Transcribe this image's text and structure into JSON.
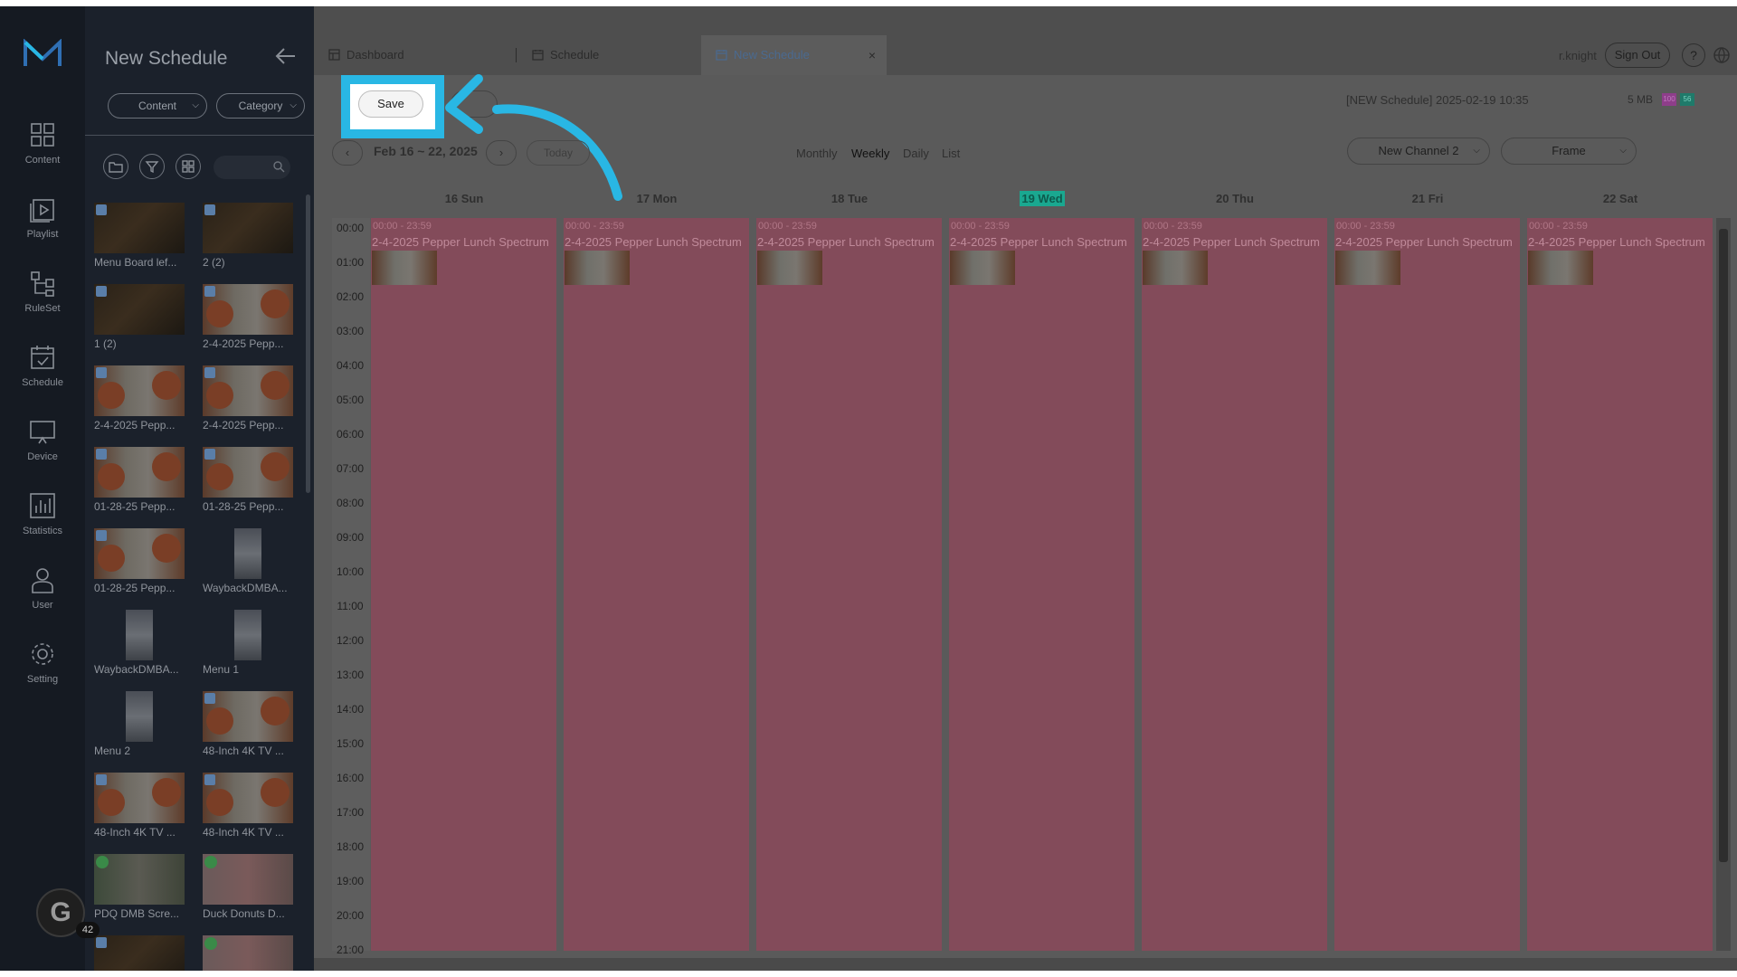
{
  "nav": {
    "items": [
      {
        "label": "Content",
        "icon": "grid-icon"
      },
      {
        "label": "Playlist",
        "icon": "playlist-icon"
      },
      {
        "label": "RuleSet",
        "icon": "ruleset-icon"
      },
      {
        "label": "Schedule",
        "icon": "calendar-icon"
      },
      {
        "label": "Device",
        "icon": "monitor-icon"
      },
      {
        "label": "Statistics",
        "icon": "chart-icon"
      },
      {
        "label": "User",
        "icon": "user-icon"
      },
      {
        "label": "Setting",
        "icon": "gear-icon"
      }
    ]
  },
  "panel": {
    "title": "New Schedule",
    "content_filter": "Content",
    "category_filter": "Category",
    "search_placeholder": "",
    "items": [
      {
        "caption": "Menu Board lef...",
        "kind": "dark"
      },
      {
        "caption": "2 (2)",
        "kind": "dark"
      },
      {
        "caption": "1 (2)",
        "kind": "dark"
      },
      {
        "caption": "2-4-2025 Pepp...",
        "kind": "food"
      },
      {
        "caption": "2-4-2025 Pepp...",
        "kind": "food"
      },
      {
        "caption": "2-4-2025 Pepp...",
        "kind": "food"
      },
      {
        "caption": "01-28-25 Pepp...",
        "kind": "food"
      },
      {
        "caption": "01-28-25 Pepp...",
        "kind": "food"
      },
      {
        "caption": "01-28-25 Pepp...",
        "kind": "food"
      },
      {
        "caption": "WaybackDMBA...",
        "kind": "menu-tall"
      },
      {
        "caption": "WaybackDMBA...",
        "kind": "menu-tall"
      },
      {
        "caption": "Menu 1",
        "kind": "menu-tall"
      },
      {
        "caption": "Menu 2",
        "kind": "menu-tall"
      },
      {
        "caption": "48-Inch 4K TV ...",
        "kind": "food"
      },
      {
        "caption": "48-Inch 4K TV ...",
        "kind": "food"
      },
      {
        "caption": "48-Inch 4K TV ...",
        "kind": "food"
      },
      {
        "caption": "PDQ DMB Scre...",
        "kind": "green"
      },
      {
        "caption": "Duck Donuts D...",
        "kind": "donut"
      },
      {
        "caption": "",
        "kind": "dark"
      },
      {
        "caption": "",
        "kind": "donut"
      }
    ]
  },
  "tabs": [
    {
      "label": "Dashboard",
      "icon": "dashboard-icon"
    },
    {
      "label": "Schedule",
      "icon": "calendar-icon"
    },
    {
      "label": "New Schedule",
      "icon": "calendar-icon",
      "close": "×"
    }
  ],
  "user": {
    "name": "r.knight",
    "signout": "Sign Out",
    "help": "?"
  },
  "toolbar": {
    "save_label": "Save"
  },
  "meta": {
    "schedule_info": "[NEW Schedule] 2025-02-19 10:35",
    "size": "5 MB",
    "badge1": "100",
    "badge2": "56"
  },
  "date_nav": {
    "prev": "‹",
    "next": "›",
    "range": "Feb 16 ~ 22, 2025",
    "today": "Today"
  },
  "views": [
    "Monthly",
    "Weekly",
    "Daily",
    "List"
  ],
  "active_view": "Weekly",
  "channel_select": "New Channel 2",
  "frame_select": "Frame",
  "calendar": {
    "days": [
      "16 Sun",
      "17 Mon",
      "18 Tue",
      "19 Wed",
      "20 Thu",
      "21 Fri",
      "22 Sat"
    ],
    "today": "19 Wed",
    "hours": [
      "00:00",
      "01:00",
      "02:00",
      "03:00",
      "04:00",
      "05:00",
      "06:00",
      "07:00",
      "08:00",
      "09:00",
      "10:00",
      "11:00",
      "12:00",
      "13:00",
      "14:00",
      "15:00",
      "16:00",
      "17:00",
      "18:00",
      "19:00",
      "20:00",
      "21:00"
    ],
    "event": {
      "time": "00:00 - 23:59",
      "title": "2-4-2025 Pepper Lunch Spectrum",
      "color": "#834b5a"
    }
  },
  "assistant": {
    "letter": "G",
    "count": "42"
  }
}
